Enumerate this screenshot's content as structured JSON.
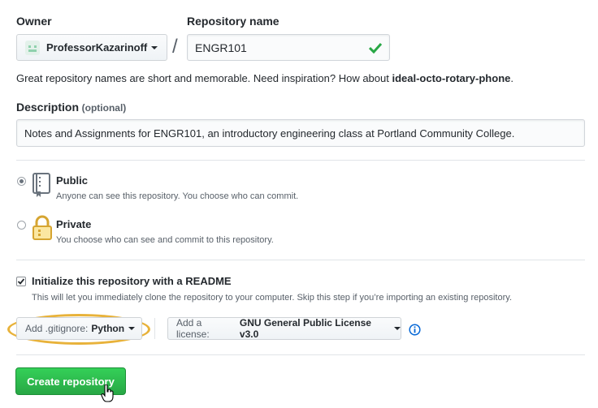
{
  "owner": {
    "label": "Owner",
    "value": "ProfessorKazarinoff"
  },
  "separator": "/",
  "repo": {
    "label": "Repository name",
    "value": "ENGR101"
  },
  "hint": {
    "text": "Great repository names are short and memorable. Need inspiration? How about ",
    "suggestion": "ideal-octo-rotary-phone",
    "end": "."
  },
  "description": {
    "label": "Description",
    "optional": "(optional)",
    "value": "Notes and Assignments for ENGR101, an introductory engineering class at Portland Community College."
  },
  "visibility": {
    "public": {
      "title": "Public",
      "desc": "Anyone can see this repository. You choose who can commit.",
      "selected": true
    },
    "private": {
      "title": "Private",
      "desc": "You choose who can see and commit to this repository.",
      "selected": false
    }
  },
  "readme": {
    "title": "Initialize this repository with a README",
    "desc": "This will let you immediately clone the repository to your computer. Skip this step if you’re importing an existing repository.",
    "checked": true
  },
  "gitignore": {
    "label": "Add .gitignore:",
    "value": "Python"
  },
  "license": {
    "label": "Add a license:",
    "value": "GNU General Public License v3.0"
  },
  "info_icon": "info-icon",
  "submit": "Create repository",
  "colors": {
    "accent_green": "#28a745",
    "highlight": "#e8b23a",
    "link_blue": "#0366d6"
  }
}
